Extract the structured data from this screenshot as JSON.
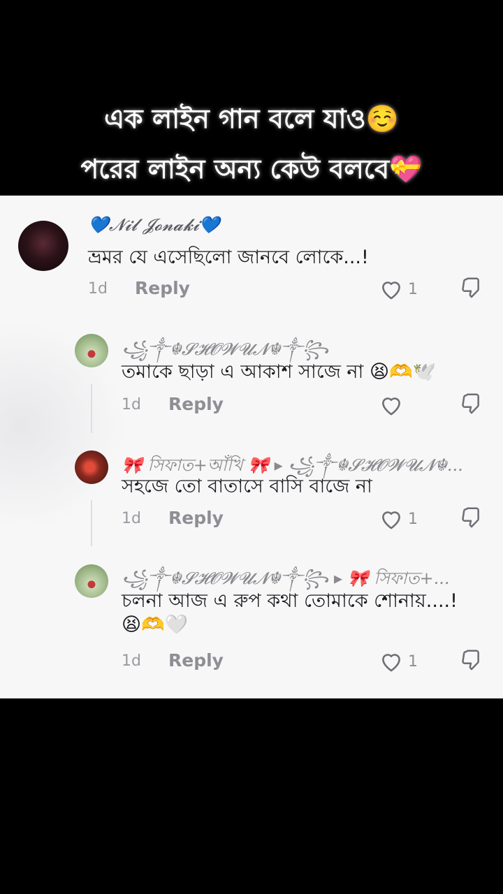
{
  "overlay": {
    "line1": "এক লাইন গান বলে যাও☺️",
    "line2": "পরের লাইন অন্য কেউ বলবে💝"
  },
  "comments": [
    {
      "username": "💙𝓝𝓲𝓵 𝓙𝓸𝓷𝓪𝓴𝓲💙",
      "text": "ভ্রমর যে এসেছিলো জানবে লোকে...!",
      "time": "1d",
      "reply_label": "Reply",
      "likes": "1"
    },
    {
      "username": "꧁༒☬𝓢𝓗𝓞𝓦𝓤𝓝☬༒꧂",
      "text": "তমাকে ছাড়া এ আকাশ সাজে না 😫🫶🕊️",
      "time": "1d",
      "reply_label": "Reply",
      "likes": ""
    },
    {
      "username": "🎀 সিফাত+আঁখি 🎀 ▸ ꧁༒☬𝓢𝓗𝓞𝓦𝓤𝓝☬...",
      "text": "সহজে তো বাতাসে বাসি বাজে না",
      "time": "1d",
      "reply_label": "Reply",
      "likes": "1"
    },
    {
      "username": "꧁༒☬𝓢𝓗𝓞𝓦𝓤𝓝☬༒꧂ ▸ 🎀 সিফাত+...",
      "text": "চলনা আজ এ রুপ কথা তোমাকে শোনায়....!",
      "text2": "😫🫶🤍",
      "time": "1d",
      "reply_label": "Reply",
      "likes": "1"
    }
  ],
  "icons": {
    "like": "heart-outline-icon",
    "dislike": "thumbs-down-icon"
  },
  "colors": {
    "panel_bg": "#f7f7f8",
    "text": "#1b1b1f",
    "muted": "#8e8e94"
  }
}
